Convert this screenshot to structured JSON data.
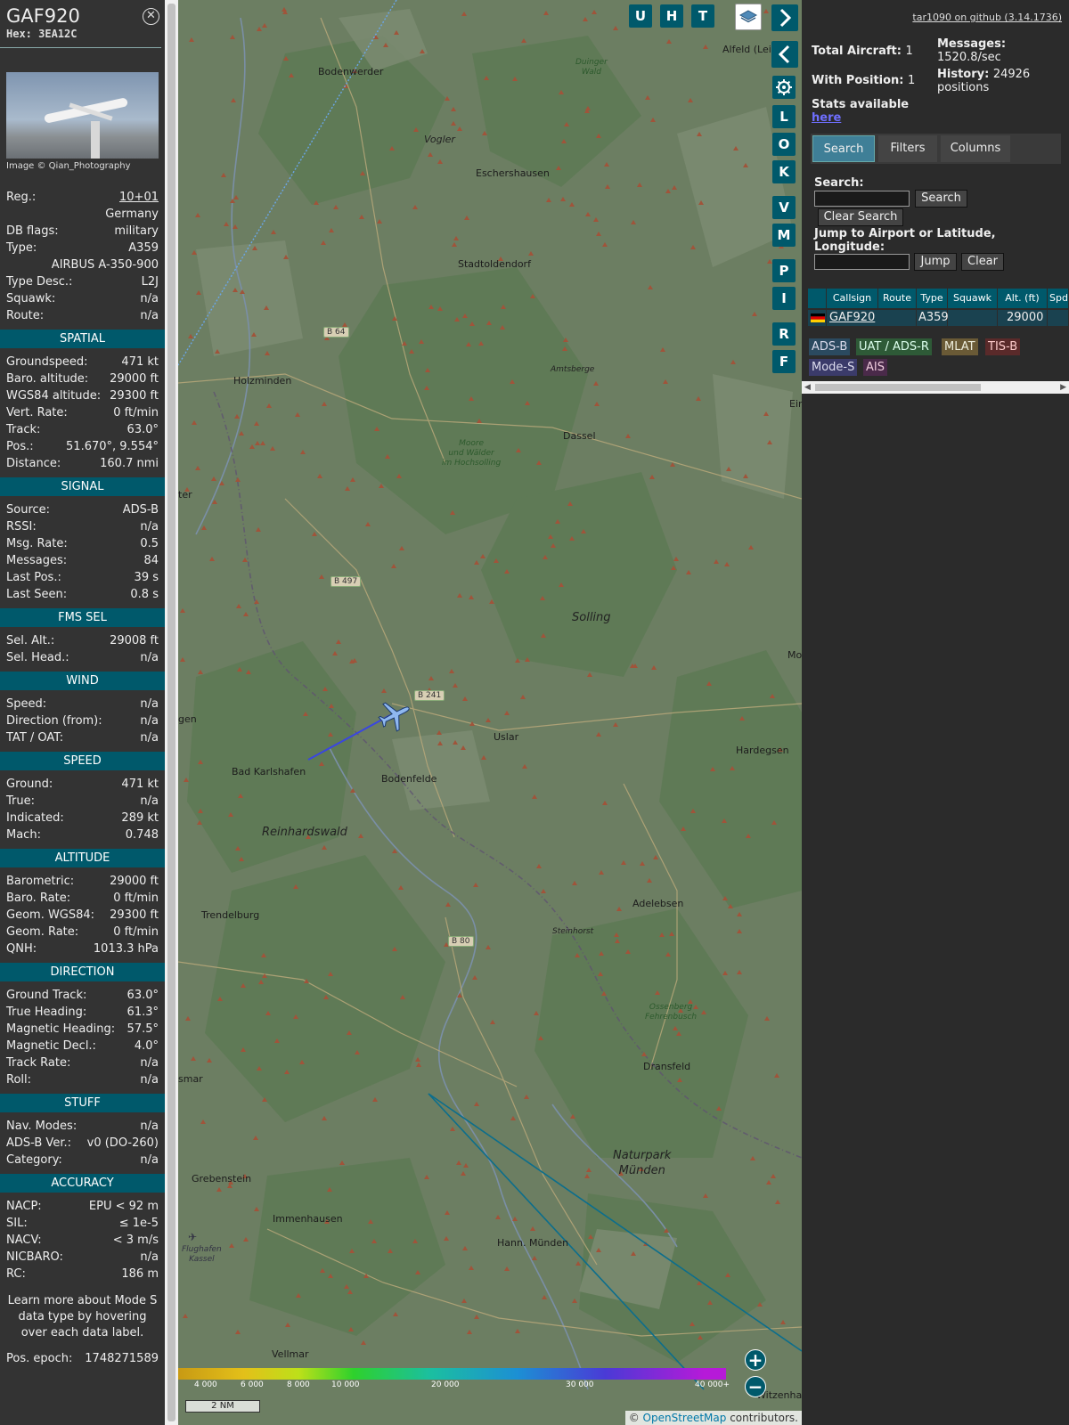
{
  "info": {
    "callsign": "GAF920",
    "hex": "Hex: 3EA12C",
    "photo_caption": "Image © Qian_Photography",
    "general": [
      {
        "k": "Reg.:",
        "v": "10+01",
        "link": true
      },
      {
        "k": "",
        "v": "Germany"
      },
      {
        "k": "DB flags:",
        "v": "military"
      },
      {
        "k": "Type:",
        "v": "A359"
      },
      {
        "k": "",
        "v": "AIRBUS A-350-900"
      },
      {
        "k": "Type Desc.:",
        "v": "L2J"
      },
      {
        "k": "Squawk:",
        "v": "n/a"
      },
      {
        "k": "Route:",
        "v": "n/a"
      }
    ],
    "sections": [
      {
        "title": "SPATIAL",
        "rows": [
          {
            "k": "Groundspeed:",
            "v": "471 kt"
          },
          {
            "k": "Baro. altitude:",
            "v": "29000 ft"
          },
          {
            "k": "WGS84 altitude:",
            "v": "29300 ft"
          },
          {
            "k": "Vert. Rate:",
            "v": "0 ft/min"
          },
          {
            "k": "Track:",
            "v": "63.0°"
          },
          {
            "k": "Pos.:",
            "v": "51.670°, 9.554°"
          },
          {
            "k": "Distance:",
            "v": "160.7 nmi"
          }
        ]
      },
      {
        "title": "SIGNAL",
        "rows": [
          {
            "k": "Source:",
            "v": "ADS-B"
          },
          {
            "k": "RSSI:",
            "v": "n/a"
          },
          {
            "k": "Msg. Rate:",
            "v": "0.5"
          },
          {
            "k": "Messages:",
            "v": "84"
          },
          {
            "k": "Last Pos.:",
            "v": "39 s"
          },
          {
            "k": "Last Seen:",
            "v": "0.8 s"
          }
        ]
      },
      {
        "title": "FMS SEL",
        "rows": [
          {
            "k": "Sel. Alt.:",
            "v": "29008 ft"
          },
          {
            "k": "Sel. Head.:",
            "v": "n/a"
          }
        ]
      },
      {
        "title": "WIND",
        "rows": [
          {
            "k": "Speed:",
            "v": "n/a"
          },
          {
            "k": "Direction (from):",
            "v": "n/a"
          },
          {
            "k": "TAT / OAT:",
            "v": "n/a"
          }
        ]
      },
      {
        "title": "SPEED",
        "rows": [
          {
            "k": "Ground:",
            "v": "471 kt"
          },
          {
            "k": "True:",
            "v": "n/a"
          },
          {
            "k": "Indicated:",
            "v": "289 kt"
          },
          {
            "k": "Mach:",
            "v": "0.748"
          }
        ]
      },
      {
        "title": "ALTITUDE",
        "rows": [
          {
            "k": "Barometric:",
            "v": "29000 ft"
          },
          {
            "k": "Baro. Rate:",
            "v": "0 ft/min"
          },
          {
            "k": "Geom. WGS84:",
            "v": "29300 ft"
          },
          {
            "k": "Geom. Rate:",
            "v": "0 ft/min"
          },
          {
            "k": "QNH:",
            "v": "1013.3 hPa"
          }
        ]
      },
      {
        "title": "DIRECTION",
        "rows": [
          {
            "k": "Ground Track:",
            "v": "63.0°"
          },
          {
            "k": "True Heading:",
            "v": "61.3°"
          },
          {
            "k": "Magnetic Heading:",
            "v": "57.5°"
          },
          {
            "k": "Magnetic Decl.:",
            "v": "4.0°"
          },
          {
            "k": "Track Rate:",
            "v": "n/a"
          },
          {
            "k": "Roll:",
            "v": "n/a"
          }
        ]
      },
      {
        "title": "STUFF",
        "rows": [
          {
            "k": "Nav. Modes:",
            "v": "n/a"
          },
          {
            "k": "ADS-B Ver.:",
            "v": "v0 (DO-260)"
          },
          {
            "k": "Category:",
            "v": "n/a"
          }
        ]
      },
      {
        "title": "ACCURACY",
        "rows": [
          {
            "k": "NACP:",
            "v": "EPU < 92 m"
          },
          {
            "k": "SIL:",
            "v": "≤ 1e-5"
          },
          {
            "k": "NACV:",
            "v": "< 3 m/s"
          },
          {
            "k": "NICBARO:",
            "v": "n/a"
          },
          {
            "k": "RC:",
            "v": "186 m"
          }
        ]
      }
    ],
    "learn_more": "Learn more about Mode S data type by hovering over each data label.",
    "pos_epoch_label": "Pos. epoch:",
    "pos_epoch_value": "1748271589"
  },
  "map": {
    "towns": [
      "Bodenwerder",
      "Eschershausen",
      "Stadtoldendorf",
      "Holzminden",
      "Dassel",
      "Uslar",
      "Bodenfelde",
      "Bad Karlshafen",
      "Hardegsen",
      "Trendelburg",
      "Adelebsen",
      "Dransfeld",
      "Grebenstein",
      "Immenhausen",
      "Hann. Münden",
      "Vellmar",
      "Alfeld (Leine)",
      "Witzenhausen",
      "gen",
      "ter",
      "smar",
      "Mo",
      "Ein"
    ],
    "regions": [
      "Vogler",
      "Solling",
      "Reinhardswald",
      "Naturpark\nMünden",
      "Amtsberge",
      "Steinhorst"
    ],
    "forests": [
      "Duinger\nWald",
      "Moore\nund Wälder\nim Hochsolling",
      "Ossenberg\nFehrenbusch"
    ],
    "roads": [
      "B 64",
      "B 497",
      "B 241",
      "B 80"
    ],
    "airport": "Flughafen\nKassel",
    "buttons": {
      "U": "U",
      "H": "H",
      "T": "T",
      "L": "L",
      "O": "O",
      "K": "K",
      "V": "V",
      "M": "M",
      "P": "P",
      "I": "I",
      "R": "R",
      "F": "F"
    },
    "altitude_legend": [
      "4 000",
      "6 000",
      "8 000",
      "10 000",
      "20 000",
      "30 000",
      "40 000+"
    ],
    "scale": "2 NM",
    "attribution_prefix": "©",
    "attribution_link": "OpenStreetMap",
    "attribution_suffix": "contributors."
  },
  "side": {
    "github_link": "tar1090 on github (3.14.1736)",
    "total_aircraft_label": "Total Aircraft:",
    "total_aircraft": "1",
    "with_position_label": "With Position:",
    "with_position": "1",
    "stats_label": "Stats available",
    "stats_link": "here",
    "messages_label": "Messages:",
    "messages_value": "1520.8/sec",
    "history_label": "History:",
    "history_value": "24926",
    "history_unit": "positions",
    "tabs": [
      "Search",
      "Filters",
      "Columns"
    ],
    "search_label": "Search:",
    "search_button": "Search",
    "clear_search_button": "Clear Search",
    "jump_label": "Jump to Airport or Latitude, Longitude:",
    "jump_button": "Jump",
    "clear_button": "Clear",
    "table_headers": [
      "",
      "Callsign",
      "Route",
      "Type",
      "Squawk",
      "Alt. (ft)",
      "Spd."
    ],
    "table_row": {
      "callsign": "GAF920",
      "route": "",
      "type": "A359",
      "squawk": "",
      "alt": "29000",
      "spd": ""
    },
    "source_tags": [
      "ADS-B",
      "UAT / ADS-R",
      "MLAT",
      "TIS-B",
      "Mode-S",
      "AIS"
    ]
  },
  "colors": {
    "accent": "#00596b",
    "panel": "#333333",
    "map": "#6c7e62",
    "track": "#3a46e0",
    "route_line": "#0c6e8c"
  }
}
